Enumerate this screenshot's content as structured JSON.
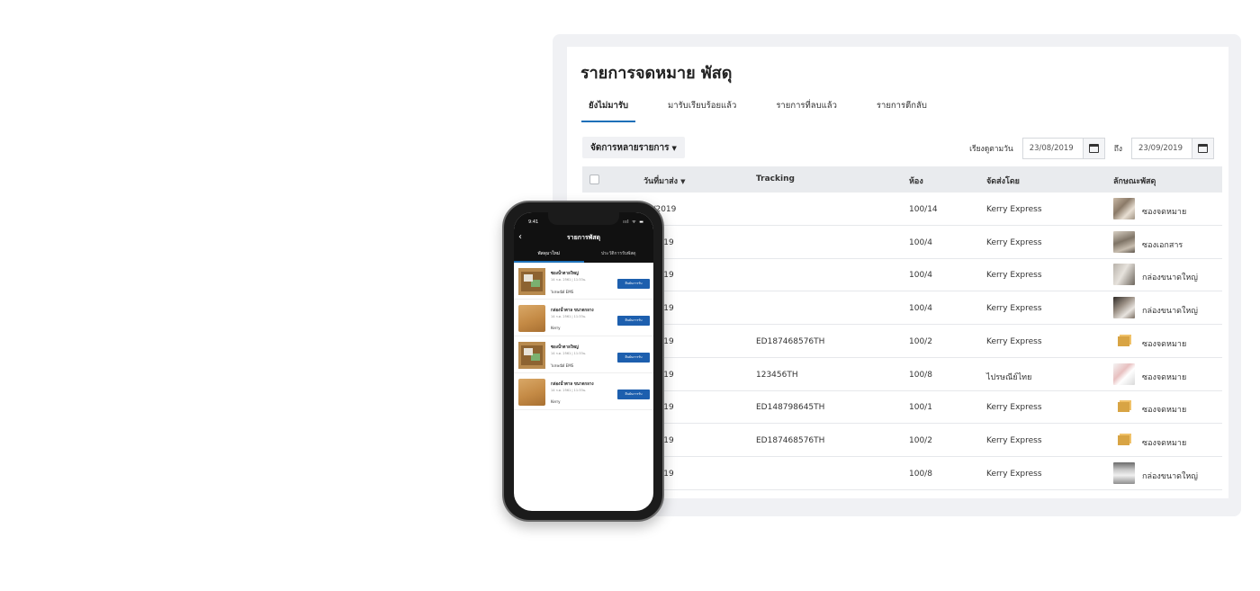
{
  "page": {
    "title": "รายการจดหมาย พัสดุ",
    "tabs": [
      "ยังไม่มารับ",
      "มารับเรียบร้อยแล้ว",
      "รายการที่ลบแล้ว",
      "รายการตีกลับ"
    ],
    "active_tab": 0,
    "bulk_action_label": "จัดการหลายรายการ",
    "date_filter": {
      "label": "เรียงดูตามวัน",
      "from": "23/08/2019",
      "to_label": "ถึง",
      "to": "23/09/2019"
    }
  },
  "table": {
    "columns": [
      "วันที่มาส่ง",
      "Tracking",
      "ห้อง",
      "จัดส่งโดย",
      "ลักษณะพัสดุ"
    ],
    "rows": [
      {
        "date": "09/2019",
        "tracking": "",
        "room": "100/14",
        "carrier": "Kerry Express",
        "type": "ซองจดหมาย",
        "thumb": "photo1"
      },
      {
        "date": "/9/2019",
        "tracking": "",
        "room": "100/4",
        "carrier": "Kerry Express",
        "type": "ซองเอกสาร",
        "thumb": "photo2"
      },
      {
        "date": "/9/2019",
        "tracking": "",
        "room": "100/4",
        "carrier": "Kerry Express",
        "type": "กล่องขนาดใหญ่",
        "thumb": "photo3"
      },
      {
        "date": "/9/2019",
        "tracking": "",
        "room": "100/4",
        "carrier": "Kerry Express",
        "type": "กล่องขนาดใหญ่",
        "thumb": "photo4"
      },
      {
        "date": "/9/2019",
        "tracking": "ED187468576TH",
        "room": "100/2",
        "carrier": "Kerry Express",
        "type": "ซองจดหมาย",
        "thumb": "box"
      },
      {
        "date": "/9/2019",
        "tracking": "123456TH",
        "room": "100/8",
        "carrier": "ไปรษณีย์ไทย",
        "type": "ซองจดหมาย",
        "thumb": "photo5"
      },
      {
        "date": "/9/2019",
        "tracking": "ED148798645TH",
        "room": "100/1",
        "carrier": "Kerry Express",
        "type": "ซองจดหมาย",
        "thumb": "box"
      },
      {
        "date": "/9/2019",
        "tracking": "ED187468576TH",
        "room": "100/2",
        "carrier": "Kerry Express",
        "type": "ซองจดหมาย",
        "thumb": "box"
      },
      {
        "date": "/9/2019",
        "tracking": "",
        "room": "100/8",
        "carrier": "Kerry Express",
        "type": "กล่องขนาดใหญ่",
        "thumb": "photo6"
      }
    ]
  },
  "mobile": {
    "time": "9:41",
    "signal": "ııl ᯤ ▬",
    "title": "รายการพัสดุ",
    "tabs": [
      "พัสดุมาใหม่",
      "ประวัติการรับพัสดุ"
    ],
    "active_tab": 0,
    "items": [
      {
        "name": "ซองน้ำตาลใหญ่",
        "date": "14 ก.ค. 2561 | 11:33น.",
        "carrier": "ไปรษณีย์ EMS",
        "button": "ยืนยันการรับ",
        "img": "env"
      },
      {
        "name": "กล่องน้ำตาล ขนาดกลาง",
        "date": "14 ก.ค. 2561 | 11:33น.",
        "carrier": "Kerry",
        "button": "ยืนยันการรับ",
        "img": "parcel"
      },
      {
        "name": "ซองน้ำตาลใหญ่",
        "date": "14 ก.ค. 2561 | 11:33น.",
        "carrier": "ไปรษณีย์ EMS",
        "button": "ยืนยันการรับ",
        "img": "env"
      },
      {
        "name": "กล่องน้ำตาล ขนาดกลาง",
        "date": "14 ก.ค. 2561 | 11:33น.",
        "carrier": "Kerry",
        "button": "ยืนยันการรับ",
        "img": "parcel"
      }
    ]
  },
  "colors": {
    "accent": "#1d70b8",
    "header_bg": "#e9ebee",
    "mobile_header": "#111111",
    "mobile_button": "#1d5fae"
  }
}
